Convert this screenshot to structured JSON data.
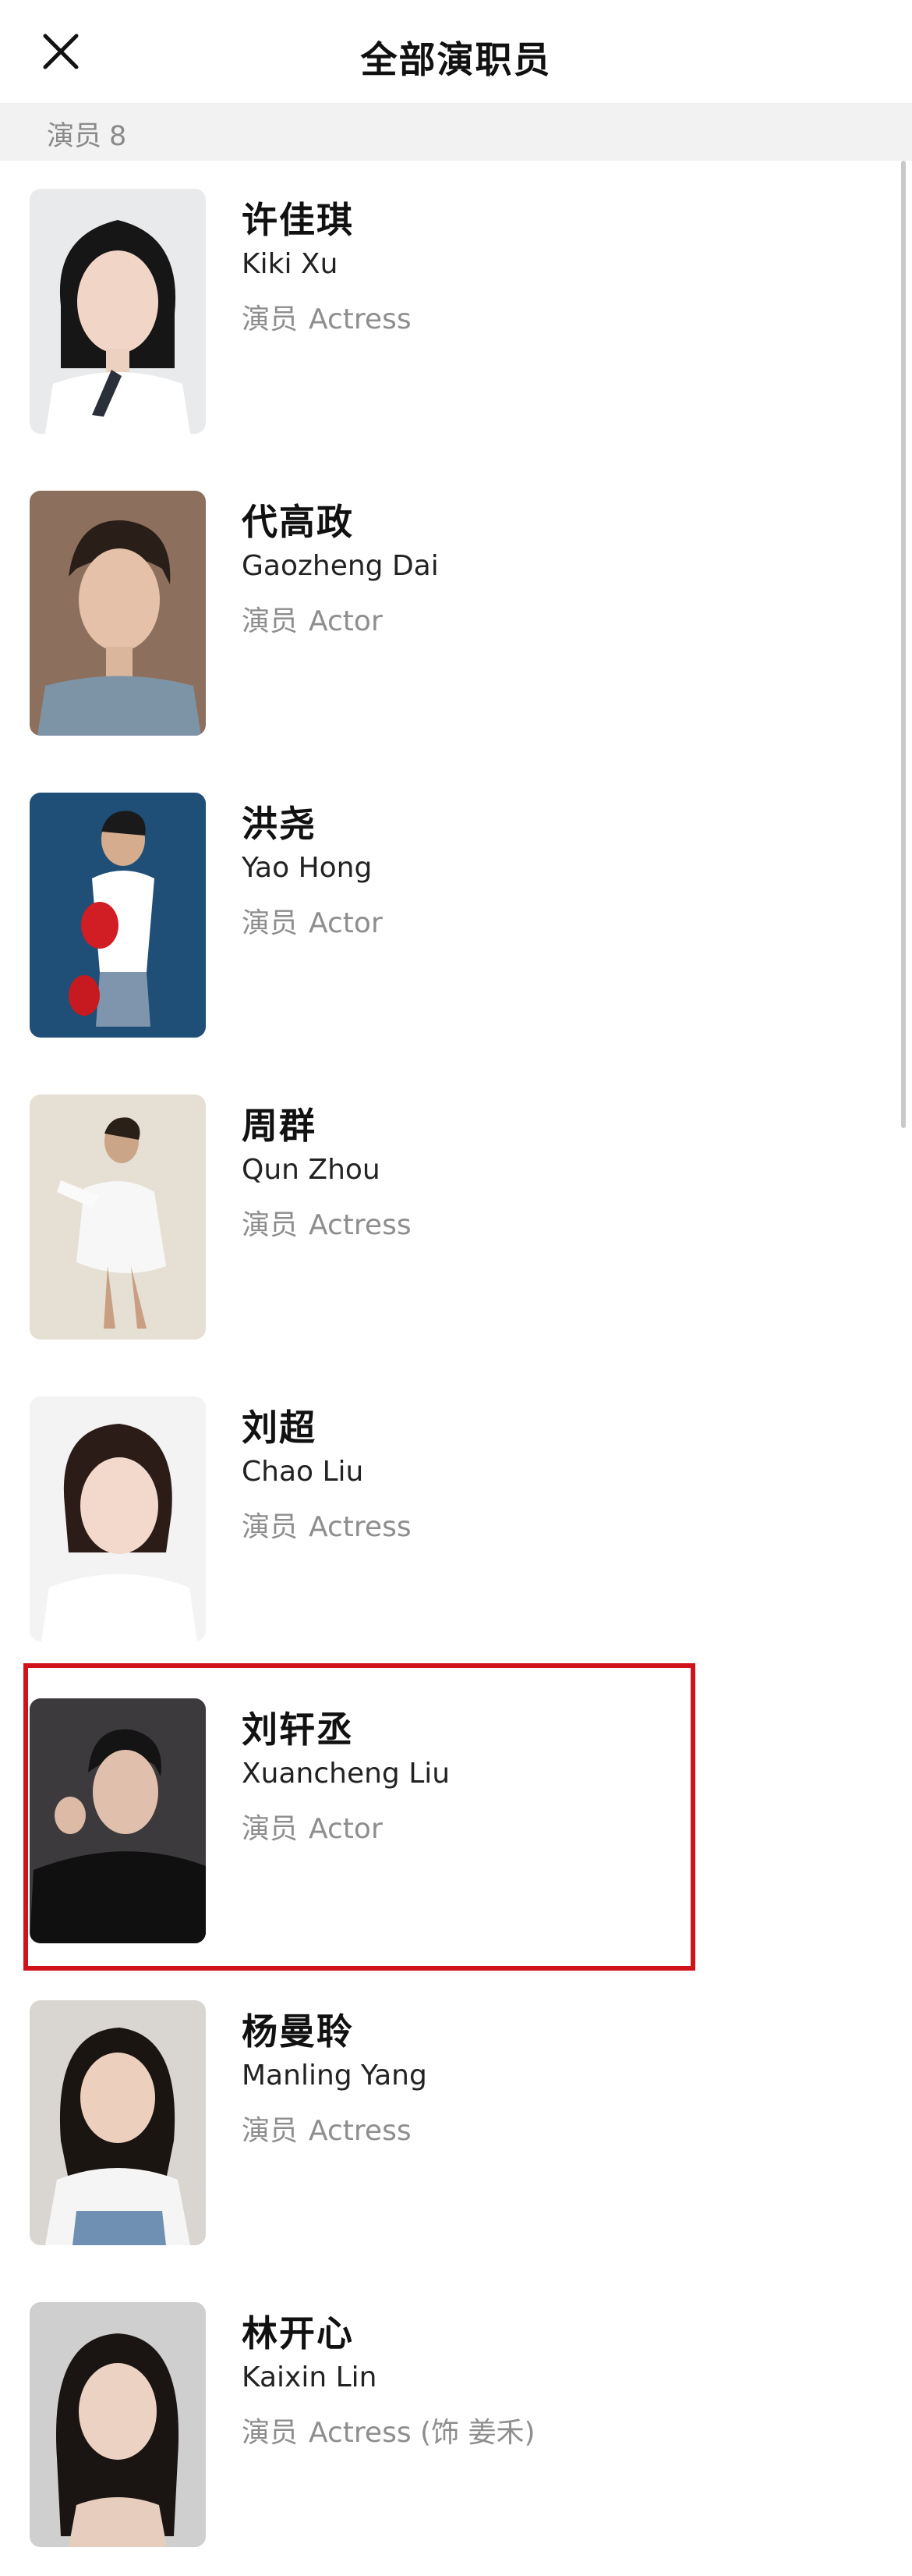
{
  "header": {
    "title": "全部演职员",
    "close_icon": "close-icon"
  },
  "section": {
    "label": "演员",
    "count": "8"
  },
  "cast": [
    {
      "cn": "许佳琪",
      "en": "Kiki Xu",
      "role_cn": "演员",
      "role_en": "Actress"
    },
    {
      "cn": "代高政",
      "en": "Gaozheng Dai",
      "role_cn": "演员",
      "role_en": "Actor"
    },
    {
      "cn": "洪尧",
      "en": "Yao Hong",
      "role_cn": "演员",
      "role_en": "Actor"
    },
    {
      "cn": "周群",
      "en": "Qun Zhou",
      "role_cn": "演员",
      "role_en": "Actress"
    },
    {
      "cn": "刘超",
      "en": "Chao Liu",
      "role_cn": "演员",
      "role_en": "Actress"
    },
    {
      "cn": "刘轩丞",
      "en": "Xuancheng Liu",
      "role_cn": "演员",
      "role_en": "Actor"
    },
    {
      "cn": "杨曼聆",
      "en": "Manling Yang",
      "role_cn": "演员",
      "role_en": "Actress"
    },
    {
      "cn": "林开心",
      "en": "Kaixin Lin",
      "role_cn": "演员",
      "role_en": "Actress (饰 姜禾)"
    }
  ],
  "colors": {
    "highlight": "#d0131b",
    "section_bg": "#f2f2f2",
    "muted_text": "#8e8e8e"
  }
}
